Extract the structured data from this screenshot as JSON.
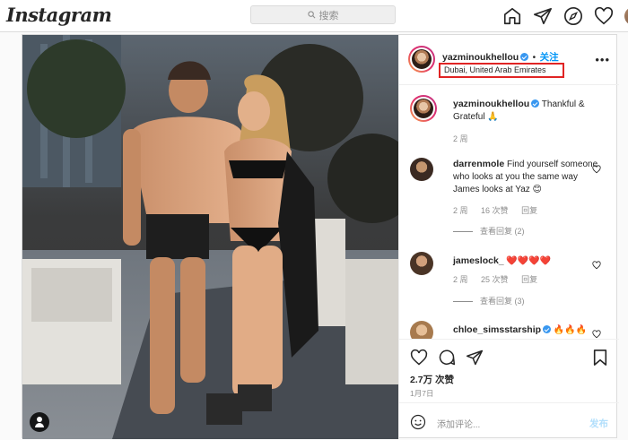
{
  "header": {
    "logo": "Instagram",
    "search_placeholder": "搜索"
  },
  "post": {
    "author": {
      "username": "yazminoukhellou",
      "follow_label": "关注",
      "separator": "•",
      "location": "Dubai, United Arab Emirates"
    },
    "caption": {
      "username": "yazminoukhellou",
      "text": "Thankful & Grateful 🙏",
      "age": "2 周"
    },
    "comments": [
      {
        "username": "darrenmole",
        "text": "Find yourself someone who looks at you the same way James looks at Yaz 😊",
        "age": "2 周",
        "likes": "16 次赞",
        "reply": "回复",
        "view_replies": "查看回复 (2)"
      },
      {
        "username": "jameslock_",
        "text": "❤️❤️❤️❤️",
        "age": "2 周",
        "likes": "25 次赞",
        "reply": "回复",
        "view_replies": "查看回复 (3)"
      },
      {
        "username": "chloe_simsstarship",
        "text": "🔥🔥🔥",
        "verified": true
      }
    ],
    "likes_count": "2.7万 次赞",
    "date": "1月7日",
    "add_comment_placeholder": "添加评论...",
    "post_button": "发布"
  },
  "colors": {
    "accent": "#0095f6",
    "highlight_box": "#e02424",
    "verified": "#3897f0"
  }
}
